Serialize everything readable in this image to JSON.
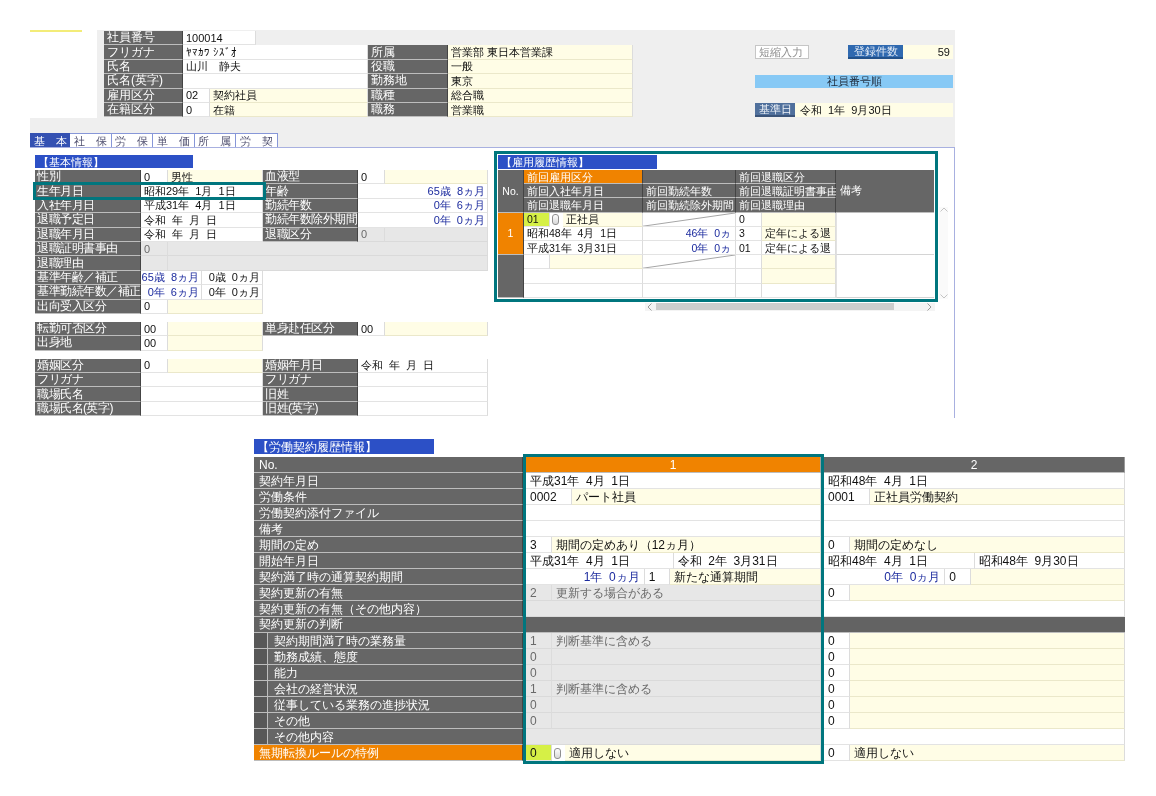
{
  "header": {
    "employee_number": {
      "label": "社員番号",
      "value": "100014"
    },
    "rows": [
      {
        "left": {
          "label": "フリガナ",
          "parts": [
            {
              "kind": "value",
              "text": "ﾔﾏｶﾜ ｼｽﾞｵ"
            }
          ]
        },
        "right": {
          "label": "所属",
          "parts": [
            {
              "kind": "name",
              "text": "営業部 東日本営業課"
            }
          ]
        }
      },
      {
        "left": {
          "label": "氏名",
          "parts": [
            {
              "kind": "value",
              "text": "山川　静夫"
            }
          ]
        },
        "right": {
          "label": "役職",
          "parts": [
            {
              "kind": "name",
              "text": "一般"
            }
          ]
        }
      },
      {
        "left": {
          "label": "氏名(英字)",
          "parts": [
            {
              "kind": "value"
            }
          ]
        },
        "right": {
          "label": "勤務地",
          "parts": [
            {
              "kind": "name",
              "text": "東京"
            }
          ]
        }
      },
      {
        "left": {
          "label": "雇用区分",
          "parts": [
            {
              "kind": "code",
              "text": "02"
            },
            {
              "kind": "name",
              "text": "契約社員"
            }
          ]
        },
        "right": {
          "label": "職種",
          "parts": [
            {
              "kind": "name",
              "text": "総合職"
            }
          ]
        }
      },
      {
        "left": {
          "label": "在籍区分",
          "parts": [
            {
              "kind": "code",
              "text": "0"
            },
            {
              "kind": "name",
              "text": "在籍"
            }
          ]
        },
        "right": {
          "label": "職務",
          "parts": [
            {
              "kind": "name",
              "text": "営業職"
            }
          ]
        }
      }
    ],
    "shortcut_field": {
      "placeholder": "短縮入力"
    },
    "record_count": {
      "label": "登録件数",
      "value": "59"
    },
    "sort_order": "社員番号順",
    "base_date": {
      "label": "基準日",
      "value": "令和  1年  9月30日"
    }
  },
  "tabs": [
    {
      "label": "基　本",
      "selected": true
    },
    {
      "label": "社　保",
      "selected": false
    },
    {
      "label": "労　保",
      "selected": false
    },
    {
      "label": "単　価",
      "selected": false
    },
    {
      "label": "所　属",
      "selected": false
    },
    {
      "label": "労　契",
      "selected": false
    }
  ],
  "basic_info": {
    "title": "【基本情報】",
    "groups": [
      {
        "rows": [
          {
            "kind": "pair",
            "fields": [
              {
                "label": "性別",
                "disabled": false,
                "highlighted": false,
                "parts": [
                  {
                    "kind": "code",
                    "text": "0"
                  },
                  {
                    "kind": "name",
                    "text": "男性"
                  }
                ]
              },
              {
                "label": "血液型",
                "disabled": false,
                "highlighted": false,
                "parts": [
                  {
                    "kind": "code",
                    "text": "0"
                  },
                  {
                    "kind": "name"
                  }
                ]
              }
            ]
          },
          {
            "kind": "pair",
            "fields": [
              {
                "label": "生年月日",
                "disabled": false,
                "highlighted": true,
                "parts": [
                  {
                    "kind": "value",
                    "text": "昭和29年  1月  1日"
                  }
                ]
              },
              {
                "label": "年齢",
                "disabled": false,
                "highlighted": false,
                "parts": [
                  {
                    "kind": "computed",
                    "text": "65歳  8ヵ月"
                  }
                ]
              }
            ]
          },
          {
            "kind": "pair",
            "fields": [
              {
                "label": "入社年月日",
                "disabled": false,
                "highlighted": false,
                "parts": [
                  {
                    "kind": "value",
                    "text": "平成31年  4月  1日"
                  }
                ]
              },
              {
                "label": "勤続年数",
                "disabled": false,
                "highlighted": false,
                "parts": [
                  {
                    "kind": "computed",
                    "text": "0年  6ヵ月"
                  }
                ]
              }
            ]
          },
          {
            "kind": "pair",
            "fields": [
              {
                "label": "退職予定日",
                "disabled": false,
                "highlighted": false,
                "parts": [
                  {
                    "kind": "value",
                    "text": "令和  年  月  日"
                  }
                ]
              },
              {
                "label": "勤続年数除外期間",
                "disabled": false,
                "highlighted": false,
                "parts": [
                  {
                    "kind": "computed",
                    "text": "0年  0ヵ月"
                  }
                ]
              }
            ]
          },
          {
            "kind": "pair",
            "fields": [
              {
                "label": "退職年月日",
                "disabled": false,
                "highlighted": false,
                "parts": [
                  {
                    "kind": "value",
                    "text": "令和  年  月  日"
                  }
                ]
              },
              {
                "label": "退職区分",
                "disabled": true,
                "highlighted": false,
                "parts": [
                  {
                    "kind": "code",
                    "text": "0"
                  },
                  {
                    "kind": "name"
                  }
                ]
              }
            ]
          },
          {
            "kind": "wide",
            "fields": [
              {
                "label": "退職証明書事由",
                "disabled": true,
                "highlighted": false,
                "parts": [
                  {
                    "kind": "code",
                    "text": "0"
                  },
                  {
                    "kind": "name"
                  }
                ]
              }
            ]
          },
          {
            "kind": "wide",
            "fields": [
              {
                "label": "退職理由",
                "disabled": true,
                "highlighted": false,
                "parts": [
                  {
                    "kind": "code"
                  },
                  {
                    "kind": "name"
                  }
                ]
              }
            ]
          },
          {
            "kind": "single",
            "fields": [
              {
                "label": "基準年齢／補正",
                "disabled": false,
                "highlighted": false,
                "parts": [
                  {
                    "kind": "computed",
                    "text": "65歳  8ヵ月"
                  },
                  {
                    "kind": "amount",
                    "text": "0歳  0ヵ月"
                  }
                ]
              }
            ]
          },
          {
            "kind": "single",
            "fields": [
              {
                "label": "基準勤続年数／補正",
                "disabled": false,
                "highlighted": false,
                "parts": [
                  {
                    "kind": "computed",
                    "text": "0年  6ヵ月"
                  },
                  {
                    "kind": "amount",
                    "text": "0年  0ヵ月"
                  }
                ]
              }
            ]
          },
          {
            "kind": "single",
            "fields": [
              {
                "label": "出向受入区分",
                "disabled": false,
                "highlighted": false,
                "parts": [
                  {
                    "kind": "code",
                    "text": "0"
                  },
                  {
                    "kind": "name"
                  }
                ]
              }
            ]
          }
        ]
      },
      {
        "rows": [
          {
            "kind": "pair",
            "fields": [
              {
                "label": "転勤可否区分",
                "disabled": false,
                "highlighted": false,
                "parts": [
                  {
                    "kind": "code",
                    "text": "00"
                  },
                  {
                    "kind": "name"
                  }
                ]
              },
              {
                "label": "単身赴任区分",
                "disabled": false,
                "highlighted": false,
                "parts": [
                  {
                    "kind": "code",
                    "text": "00"
                  },
                  {
                    "kind": "name"
                  }
                ]
              }
            ]
          },
          {
            "kind": "single",
            "fields": [
              {
                "label": "出身地",
                "disabled": false,
                "highlighted": false,
                "parts": [
                  {
                    "kind": "code",
                    "text": "00"
                  },
                  {
                    "kind": "name"
                  }
                ]
              }
            ]
          }
        ]
      },
      {
        "rows": [
          {
            "kind": "pair",
            "fields": [
              {
                "label": "婚姻区分",
                "disabled": false,
                "highlighted": false,
                "parts": [
                  {
                    "kind": "code",
                    "text": "0"
                  },
                  {
                    "kind": "name"
                  }
                ]
              },
              {
                "label": "婚姻年月日",
                "disabled": false,
                "highlighted": false,
                "parts": [
                  {
                    "kind": "value",
                    "text": "令和  年  月  日"
                  }
                ]
              }
            ]
          },
          {
            "kind": "pair",
            "fields": [
              {
                "label": "フリガナ",
                "disabled": false,
                "highlighted": false,
                "parts": [
                  {
                    "kind": "value"
                  }
                ]
              },
              {
                "label": "フリガナ",
                "disabled": false,
                "highlighted": false,
                "parts": [
                  {
                    "kind": "value"
                  }
                ]
              }
            ]
          },
          {
            "kind": "pair",
            "fields": [
              {
                "label": "職場氏名",
                "disabled": false,
                "highlighted": false,
                "parts": [
                  {
                    "kind": "value"
                  }
                ]
              },
              {
                "label": "旧姓",
                "disabled": false,
                "highlighted": false,
                "parts": [
                  {
                    "kind": "value"
                  }
                ]
              }
            ]
          },
          {
            "kind": "pair",
            "fields": [
              {
                "label": "職場氏名(英字)",
                "disabled": false,
                "highlighted": false,
                "parts": [
                  {
                    "kind": "value"
                  }
                ]
              },
              {
                "label": "旧姓(英字)",
                "disabled": false,
                "highlighted": false,
                "parts": [
                  {
                    "kind": "value"
                  }
                ]
              }
            ]
          }
        ]
      }
    ]
  },
  "employment_history": {
    "title": "【雇用履歴情報】",
    "highlighted": true,
    "number_label": "No.",
    "remarks_label": "備考",
    "header_rows": [
      {
        "cells": [
          {
            "label": "前回雇用区分",
            "focused": true
          },
          {
            "focused": false
          },
          {
            "label": "前回退職区分",
            "focused": false
          }
        ]
      },
      {
        "cells": [
          {
            "label": "前回入社年月日",
            "focused": false
          },
          {
            "label": "前回勤続年数",
            "focused": false
          },
          {
            "label": "前回退職証明書事由",
            "focused": false
          }
        ]
      },
      {
        "cells": [
          {
            "label": "前回退職年月日",
            "focused": false
          },
          {
            "label": "前回勤続除外期間",
            "focused": false
          },
          {
            "label": "前回退職理由",
            "focused": false
          }
        ]
      }
    ],
    "records": [
      {
        "number": "1",
        "selected": true,
        "lines": [
          {
            "cells": [
              [
                {
                  "kind": "code",
                  "text": "01"
                },
                {
                  "kind": "lookup"
                },
                {
                  "kind": "name",
                  "text": "正社員"
                }
              ],
              [
                {
                  "kind": "slash"
                }
              ],
              [
                {
                  "kind": "code",
                  "text": "0"
                },
                {
                  "kind": "name"
                }
              ]
            ]
          },
          {
            "cells": [
              [
                {
                  "kind": "value",
                  "text": "昭和48年  4月  1日"
                }
              ],
              [
                {
                  "kind": "computed",
                  "text": "46年  0ヵ"
                }
              ],
              [
                {
                  "kind": "code",
                  "text": "3"
                },
                {
                  "kind": "name",
                  "text": "定年による退"
                }
              ]
            ]
          },
          {
            "cells": [
              [
                {
                  "kind": "value",
                  "text": "平成31年  3月31日"
                }
              ],
              [
                {
                  "kind": "computed",
                  "text": "0年  0ヵ"
                }
              ],
              [
                {
                  "kind": "code",
                  "text": "01"
                },
                {
                  "kind": "value",
                  "text": "定年による退"
                }
              ]
            ]
          }
        ]
      },
      {
        "selected": false,
        "lines": [
          {
            "cells": [
              [
                {
                  "kind": "code"
                },
                {
                  "kind": "name"
                }
              ],
              [
                {
                  "kind": "slash"
                }
              ],
              [
                {
                  "kind": "code"
                },
                {
                  "kind": "name"
                }
              ]
            ]
          },
          {
            "cells": [
              [
                {
                  "kind": "value"
                }
              ],
              [
                {
                  "kind": "value"
                }
              ],
              [
                {
                  "kind": "code"
                },
                {
                  "kind": "name"
                }
              ]
            ]
          },
          {
            "cells": [
              [
                {
                  "kind": "value"
                }
              ],
              [
                {
                  "kind": "value"
                }
              ],
              [
                {
                  "kind": "code"
                },
                {
                  "kind": "value"
                }
              ]
            ]
          }
        ]
      }
    ]
  },
  "contract_history": {
    "title": "【労働契約履歴情報】",
    "number_label": "No.",
    "columns": [
      {
        "number": "1",
        "selected": true,
        "highlighted": true
      },
      {
        "number": "2",
        "selected": false,
        "highlighted": false
      }
    ],
    "rows": [
      {
        "kind": "field",
        "label": "契約年月日",
        "focused": false,
        "values": [
          {
            "disabled": false,
            "parts": [
              {
                "kind": "value",
                "text": "平成31年  4月  1日"
              }
            ]
          },
          {
            "disabled": false,
            "parts": [
              {
                "kind": "value",
                "text": "昭和48年  4月  1日"
              }
            ]
          }
        ]
      },
      {
        "kind": "field",
        "label": "労働条件",
        "focused": false,
        "values": [
          {
            "disabled": false,
            "parts": [
              {
                "kind": "code",
                "text": "0002"
              },
              {
                "kind": "name",
                "text": "パート社員"
              }
            ]
          },
          {
            "disabled": false,
            "parts": [
              {
                "kind": "code",
                "text": "0001"
              },
              {
                "kind": "name",
                "text": "正社員労働契約"
              }
            ]
          }
        ]
      },
      {
        "kind": "field",
        "label": "労働契約添付ファイル",
        "focused": false,
        "values": [
          {
            "disabled": false,
            "parts": [
              {
                "kind": "value"
              }
            ]
          },
          {
            "disabled": false,
            "parts": [
              {
                "kind": "value"
              }
            ]
          }
        ]
      },
      {
        "kind": "field",
        "label": "備考",
        "focused": false,
        "values": [
          {
            "disabled": false,
            "parts": [
              {
                "kind": "value"
              }
            ]
          },
          {
            "disabled": false,
            "parts": [
              {
                "kind": "value"
              }
            ]
          }
        ]
      },
      {
        "kind": "field",
        "label": "期間の定め",
        "focused": false,
        "values": [
          {
            "disabled": false,
            "parts": [
              {
                "kind": "code",
                "text": "3"
              },
              {
                "kind": "name",
                "text": "期間の定めあり（12ヵ月）"
              }
            ]
          },
          {
            "disabled": false,
            "parts": [
              {
                "kind": "code",
                "text": "0"
              },
              {
                "kind": "name",
                "text": "期間の定めなし"
              }
            ]
          }
        ]
      },
      {
        "kind": "field",
        "label": "開始年月日",
        "focused": false,
        "values": [
          {
            "disabled": false,
            "parts": [
              {
                "kind": "value",
                "text": "平成31年  4月  1日"
              },
              {
                "kind": "value",
                "text": "令和  2年  3月31日"
              }
            ]
          },
          {
            "disabled": false,
            "parts": [
              {
                "kind": "value",
                "text": "昭和48年  4月  1日"
              },
              {
                "kind": "value",
                "text": "昭和48年  9月30日"
              }
            ]
          }
        ]
      },
      {
        "kind": "field",
        "label": "契約満了時の通算契約期間",
        "focused": false,
        "values": [
          {
            "disabled": false,
            "parts": [
              {
                "kind": "computed",
                "text": "1年  0ヵ月"
              },
              {
                "kind": "code",
                "text": "1"
              },
              {
                "kind": "name",
                "text": "新たな通算期間"
              }
            ]
          },
          {
            "disabled": false,
            "parts": [
              {
                "kind": "computed",
                "text": "0年  0ヵ月"
              },
              {
                "kind": "code",
                "text": "0"
              },
              {
                "kind": "name"
              }
            ]
          }
        ]
      },
      {
        "kind": "field",
        "label": "契約更新の有無",
        "focused": false,
        "values": [
          {
            "disabled": true,
            "parts": [
              {
                "kind": "code",
                "text": "2"
              },
              {
                "kind": "name",
                "text": "更新する場合がある"
              }
            ]
          },
          {
            "disabled": false,
            "parts": [
              {
                "kind": "code",
                "text": "0"
              },
              {
                "kind": "name"
              }
            ]
          }
        ]
      },
      {
        "kind": "field",
        "label": "契約更新の有無（その他内容）",
        "focused": false,
        "values": [
          {
            "disabled": true,
            "parts": [
              {
                "kind": "value"
              }
            ]
          },
          {
            "disabled": false,
            "parts": [
              {
                "kind": "value"
              }
            ]
          }
        ]
      },
      {
        "kind": "section",
        "label": "契約更新の判断",
        "focused": false
      },
      {
        "kind": "subfield",
        "label": "契約期間満了時の業務量",
        "focused": false,
        "values": [
          {
            "disabled": true,
            "parts": [
              {
                "kind": "code",
                "text": "1"
              },
              {
                "kind": "name",
                "text": "判断基準に含める"
              }
            ]
          },
          {
            "disabled": false,
            "parts": [
              {
                "kind": "code",
                "text": "0"
              },
              {
                "kind": "name"
              }
            ]
          }
        ]
      },
      {
        "kind": "subfield",
        "label": "勤務成績、態度",
        "focused": false,
        "values": [
          {
            "disabled": true,
            "parts": [
              {
                "kind": "code",
                "text": "0"
              },
              {
                "kind": "name"
              }
            ]
          },
          {
            "disabled": false,
            "parts": [
              {
                "kind": "code",
                "text": "0"
              },
              {
                "kind": "name"
              }
            ]
          }
        ]
      },
      {
        "kind": "subfield",
        "label": "能力",
        "focused": false,
        "values": [
          {
            "disabled": true,
            "parts": [
              {
                "kind": "code",
                "text": "0"
              },
              {
                "kind": "name"
              }
            ]
          },
          {
            "disabled": false,
            "parts": [
              {
                "kind": "code",
                "text": "0"
              },
              {
                "kind": "name"
              }
            ]
          }
        ]
      },
      {
        "kind": "subfield",
        "label": "会社の経営状況",
        "focused": false,
        "values": [
          {
            "disabled": true,
            "parts": [
              {
                "kind": "code",
                "text": "1"
              },
              {
                "kind": "name",
                "text": "判断基準に含める"
              }
            ]
          },
          {
            "disabled": false,
            "parts": [
              {
                "kind": "code",
                "text": "0"
              },
              {
                "kind": "name"
              }
            ]
          }
        ]
      },
      {
        "kind": "subfield",
        "label": "従事している業務の進捗状況",
        "focused": false,
        "values": [
          {
            "disabled": true,
            "parts": [
              {
                "kind": "code",
                "text": "0"
              },
              {
                "kind": "name"
              }
            ]
          },
          {
            "disabled": false,
            "parts": [
              {
                "kind": "code",
                "text": "0"
              },
              {
                "kind": "name"
              }
            ]
          }
        ]
      },
      {
        "kind": "subfield",
        "label": "その他",
        "focused": false,
        "values": [
          {
            "disabled": true,
            "parts": [
              {
                "kind": "code",
                "text": "0"
              },
              {
                "kind": "name"
              }
            ]
          },
          {
            "disabled": false,
            "parts": [
              {
                "kind": "code",
                "text": "0"
              },
              {
                "kind": "name"
              }
            ]
          }
        ]
      },
      {
        "kind": "subfield",
        "label": "その他内容",
        "focused": false,
        "values": [
          {
            "disabled": true,
            "parts": [
              {
                "kind": "value"
              }
            ]
          },
          {
            "disabled": false,
            "parts": [
              {
                "kind": "value"
              }
            ]
          }
        ]
      },
      {
        "kind": "field",
        "label": "無期転換ルールの特例",
        "focused": true,
        "values": [
          {
            "disabled": false,
            "parts": [
              {
                "kind": "code",
                "text": "0"
              },
              {
                "kind": "lookup"
              },
              {
                "kind": "name",
                "text": "適用しない"
              }
            ]
          },
          {
            "disabled": false,
            "parts": [
              {
                "kind": "code",
                "text": "0"
              },
              {
                "kind": "name",
                "text": "適用しない"
              }
            ]
          }
        ]
      }
    ]
  }
}
